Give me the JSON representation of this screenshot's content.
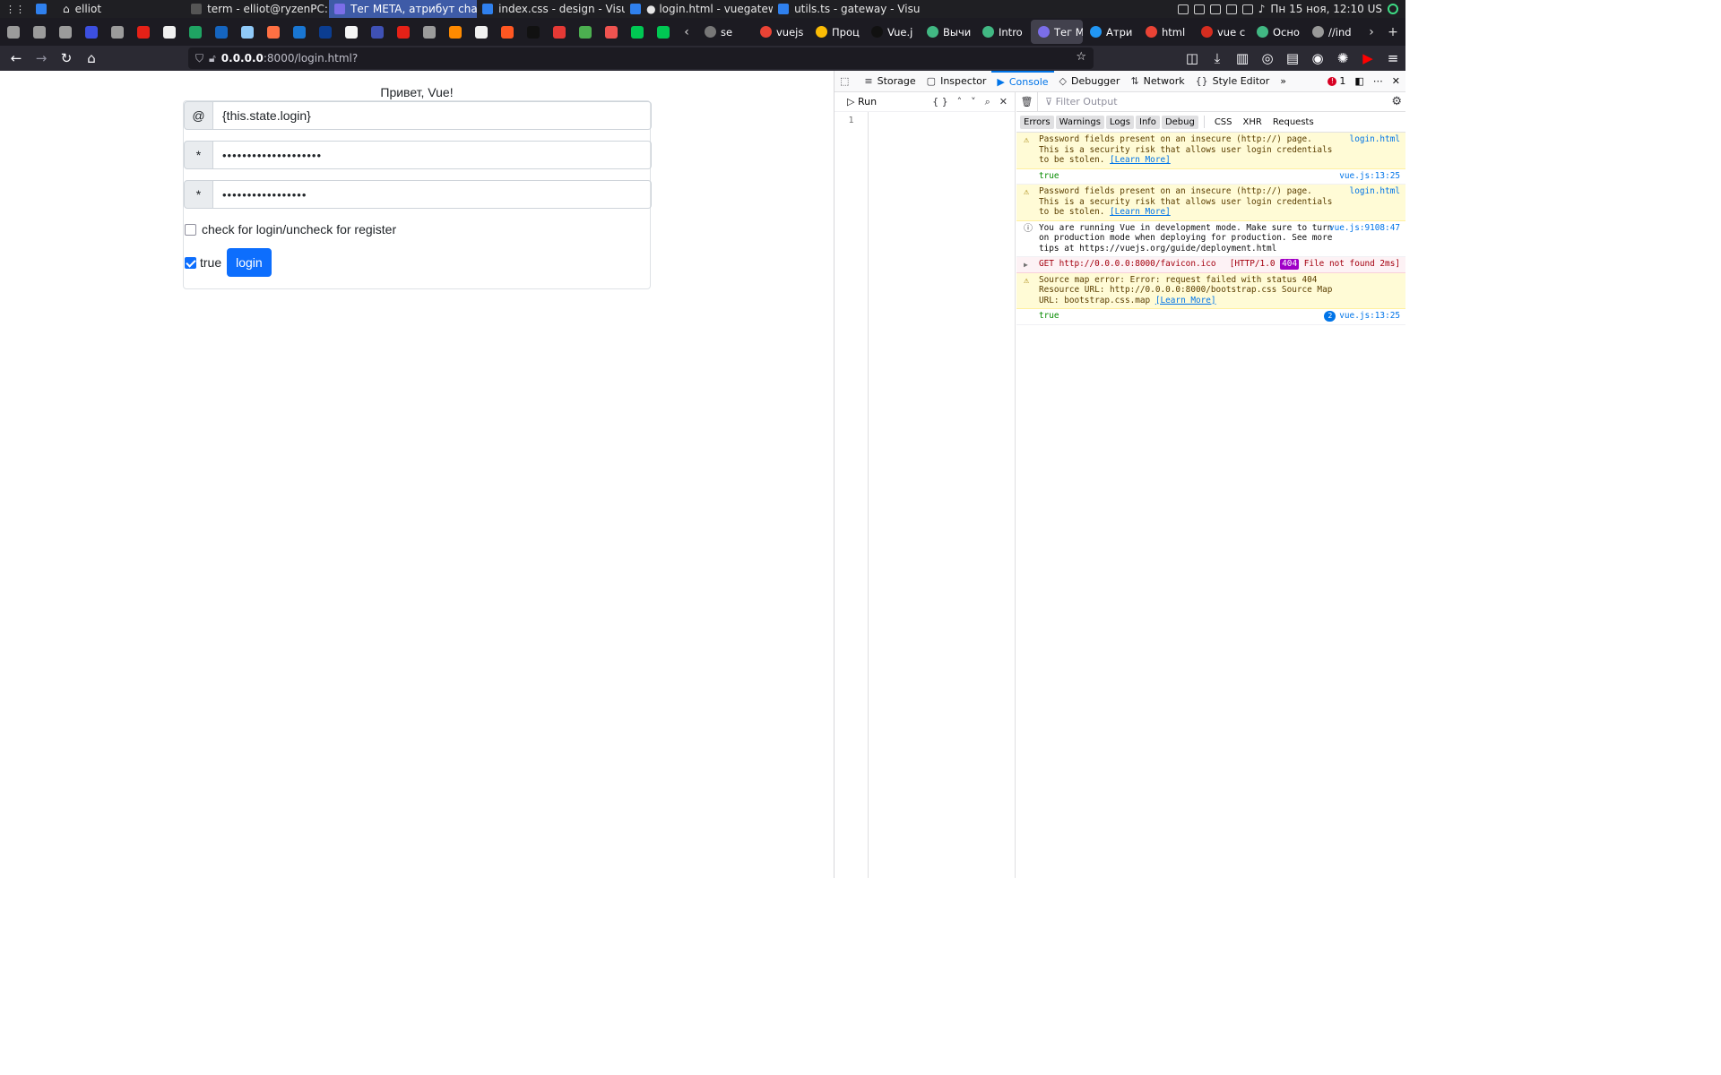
{
  "panel": {
    "user_label": "elliot",
    "windows": [
      {
        "label": "term - elliot@ryzenPC: ~",
        "active": false,
        "color": "#555555"
      },
      {
        "label": "Тег META, атрибут charse...",
        "active": true,
        "color": "#7b6ee8"
      },
      {
        "label": "index.css - design - Visual...",
        "active": false,
        "color": "#2f80ed"
      },
      {
        "label": "● login.html - vuegateway...",
        "active": false,
        "color": "#2f80ed"
      },
      {
        "label": "utils.ts - gateway - Visual ...",
        "active": false,
        "color": "#2f80ed"
      }
    ],
    "clock": "Пн 15 ноя, 12:10 US"
  },
  "tabs": [
    {
      "label": "se",
      "color": "#777777"
    },
    {
      "label": "vuejs",
      "color": "#ea4335"
    },
    {
      "label": "Проц",
      "color": "#fbbc05"
    },
    {
      "label": "Vue.j",
      "color": "#111111"
    },
    {
      "label": "Вычи",
      "color": "#41b883"
    },
    {
      "label": "Intro",
      "color": "#41b883"
    },
    {
      "label": "Тег ME",
      "color": "#7b6ee8",
      "selected": true
    },
    {
      "label": "Атри",
      "color": "#2196f3"
    },
    {
      "label": "html",
      "color": "#ea4335"
    },
    {
      "label": "vue c",
      "color": "#d62d20"
    },
    {
      "label": "Осно",
      "color": "#41b883"
    },
    {
      "label": "//ind",
      "color": "#999999"
    }
  ],
  "pinned_colors": [
    "#9b9b9b",
    "#9b9b9b",
    "#9b9b9b",
    "#3c4fe0",
    "#9b9b9b",
    "#e62117",
    "#f0f0f0",
    "#1fa463",
    "#1565c0",
    "#90caf9",
    "#ff7043",
    "#1976d2",
    "#0b3d91",
    "#f5f5f5",
    "#3f51b5",
    "#e62117",
    "#9b9b9b",
    "#ff8a00",
    "#f0f0f0",
    "#ff5722",
    "#111111",
    "#e53935",
    "#4caf50",
    "#ef5350",
    "#00c853",
    "#00c853"
  ],
  "navbar": {
    "url_host": "0.0.0.0",
    "url_rest": ":8000/login.html?"
  },
  "page": {
    "greeting": "Привет, Vue!",
    "login_prefix": "@",
    "login_value": "{this.state.login}",
    "password_prefix": "*",
    "password_value": "••••••••••••••••••••",
    "confirm_prefix": "*",
    "confirm_value": "•••••••••••••••••",
    "register_checkbox_label": "check for login/uncheck for register",
    "true_label": "true",
    "login_button": "login"
  },
  "devtools": {
    "tabs": [
      {
        "label": "Storage",
        "icon": "≡"
      },
      {
        "label": "Inspector",
        "icon": "▢"
      },
      {
        "label": "Console",
        "icon": "▶",
        "selected": true
      },
      {
        "label": "Debugger",
        "icon": "◇"
      },
      {
        "label": "Network",
        "icon": "⇅"
      },
      {
        "label": "Style Editor",
        "icon": "{}"
      }
    ],
    "error_count": "1",
    "editor_run": "Run",
    "editor_line": "1",
    "filter_placeholder": "Filter Output",
    "levels": [
      "Errors",
      "Warnings",
      "Logs",
      "Info",
      "Debug"
    ],
    "categories": [
      "CSS",
      "XHR",
      "Requests"
    ],
    "messages": [
      {
        "type": "warn",
        "text": "Password fields present on an insecure (http://) page. This is a security risk that allows user login credentials to be stolen.",
        "link": "[Learn More]",
        "source": "login.html"
      },
      {
        "type": "log",
        "text": "true",
        "source": "vue.js:13:25"
      },
      {
        "type": "warn",
        "text": "Password fields present on an insecure (http://) page. This is a security risk that allows user login credentials to be stolen.",
        "link": "[Learn More]",
        "source": "login.html"
      },
      {
        "type": "info",
        "text": "You are running Vue in development mode. Make sure to turn on production mode when deploying for production. See more tips at https://vuejs.org/guide/deployment.html",
        "source": "vue.js:9108:47"
      },
      {
        "type": "err",
        "text": "GET http://0.0.0.0:8000/favicon.ico",
        "status": "[HTTP/1.0",
        "code": "404",
        "status2": "File not found 2ms]"
      },
      {
        "type": "warn",
        "text": "Source map error: Error: request failed with status 404 Resource URL: http://0.0.0.0:8000/bootstrap.css Source Map URL: bootstrap.css.map",
        "link": "[Learn More]"
      },
      {
        "type": "log",
        "text": "true",
        "repeat": "2",
        "source": "vue.js:13:25"
      }
    ]
  }
}
